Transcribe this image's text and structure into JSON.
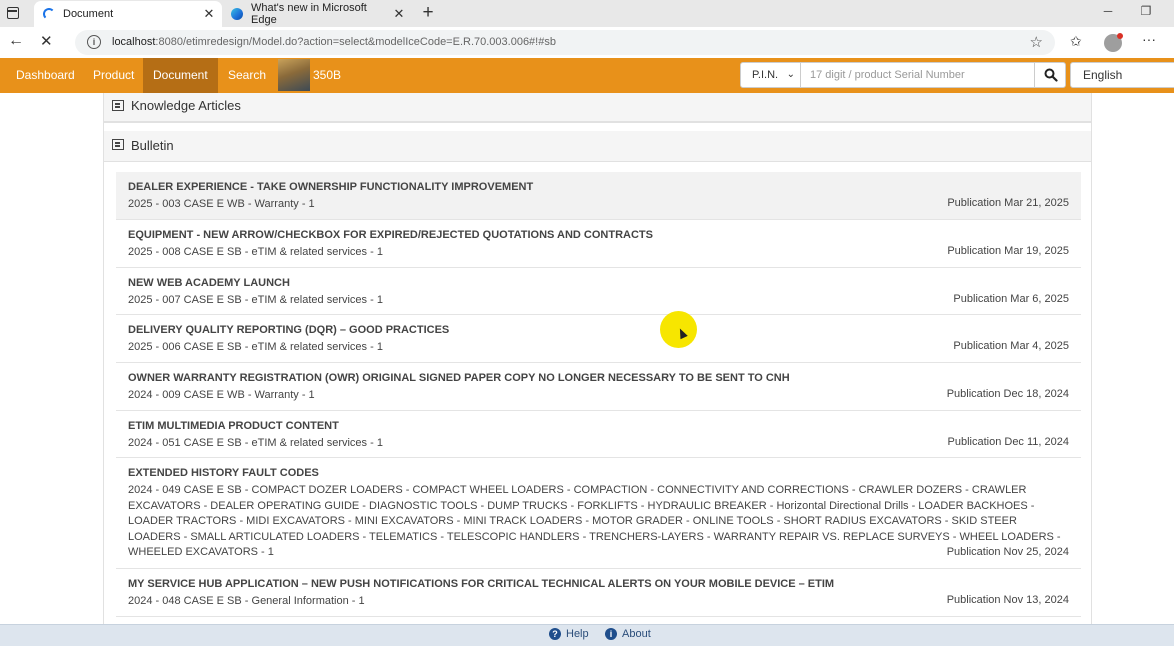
{
  "browser": {
    "tabs": [
      {
        "title": "Document",
        "active": true
      },
      {
        "title": "What's new in Microsoft Edge",
        "active": false
      }
    ],
    "url_host": "localhost",
    "url_rest": ":8080/etimredesign/Model.do?action=select&modelIceCode=E.R.70.003.006#!#sb",
    "icons": [
      "back-icon",
      "stop-icon",
      "info-icon",
      "favorite-star-icon",
      "collections-icon",
      "profile-icon",
      "more-icon"
    ]
  },
  "appnav": {
    "items": [
      "Dashboard",
      "Product",
      "Document",
      "Search"
    ],
    "active_item": "Document",
    "model_label": "350B",
    "pin_select": "P.I.N.",
    "serial_placeholder": "17 digit / product Serial Number",
    "language": "English",
    "accent_color": "#e8911a",
    "active_color": "#b56e15"
  },
  "panels": {
    "knowledge_articles": "Knowledge Articles",
    "bulletin": "Bulletin"
  },
  "bulletins": [
    {
      "title": "DEALER EXPERIENCE - TAKE OWNERSHIP FUNCTIONALITY IMPROVEMENT",
      "sub": "2025 - 003 CASE E WB - Warranty - 1",
      "pub": "Publication Mar 21, 2025"
    },
    {
      "title": "EQUIPMENT - NEW ARROW/CHECKBOX FOR EXPIRED/REJECTED QUOTATIONS AND CONTRACTS",
      "sub": "2025 - 008 CASE E SB - eTIM & related services - 1",
      "pub": "Publication Mar 19, 2025"
    },
    {
      "title": "NEW WEB ACADEMY LAUNCH",
      "sub": "2025 - 007 CASE E SB - eTIM & related services - 1",
      "pub": "Publication Mar 6, 2025"
    },
    {
      "title": "DELIVERY QUALITY REPORTING (DQR) – GOOD PRACTICES",
      "sub": "2025 - 006 CASE E SB - eTIM & related services - 1",
      "pub": "Publication Mar 4, 2025"
    },
    {
      "title": "OWNER WARRANTY REGISTRATION (OWR) ORIGINAL SIGNED PAPER COPY NO LONGER NECESSARY TO BE SENT TO CNH",
      "sub": "2024 - 009 CASE E WB - Warranty - 1",
      "pub": "Publication Dec 18, 2024"
    },
    {
      "title": "ETIM MULTIMEDIA PRODUCT CONTENT",
      "sub": "2024 - 051 CASE E SB - eTIM & related services - 1",
      "pub": "Publication Dec 11, 2024"
    },
    {
      "title": "EXTENDED HISTORY FAULT CODES",
      "sub": "2024 - 049 CASE E SB - COMPACT DOZER LOADERS - COMPACT WHEEL LOADERS - COMPACTION - CONNECTIVITY AND CORRECTIONS - CRAWLER DOZERS - CRAWLER EXCAVATORS - DEALER OPERATING GUIDE - DIAGNOSTIC TOOLS - DUMP TRUCKS - FORKLIFTS - HYDRAULIC BREAKER - Horizontal Directional Drills - LOADER BACKHOES - LOADER TRACTORS - MIDI EXCAVATORS - MINI EXCAVATORS - MINI TRACK LOADERS - MOTOR GRADER - ONLINE TOOLS - SHORT RADIUS EXCAVATORS - SKID STEER LOADERS - SMALL ARTICULATED LOADERS - TELEMATICS - TELESCOPIC HANDLERS - TRENCHERS-LAYERS - WARRANTY REPAIR VS. REPLACE SURVEYS - WHEEL LOADERS - WHEELED EXCAVATORS - 1",
      "pub": "Publication Nov 25, 2024"
    },
    {
      "title": "MY SERVICE HUB APPLICATION – NEW PUSH NOTIFICATIONS FOR CRITICAL TECHNICAL ALERTS ON YOUR MOBILE DEVICE – ETIM",
      "sub": "2024 - 048 CASE E SB - General Information - 1",
      "pub": "Publication Nov 13, 2024"
    }
  ],
  "footer": {
    "help": "Help",
    "about": "About"
  }
}
